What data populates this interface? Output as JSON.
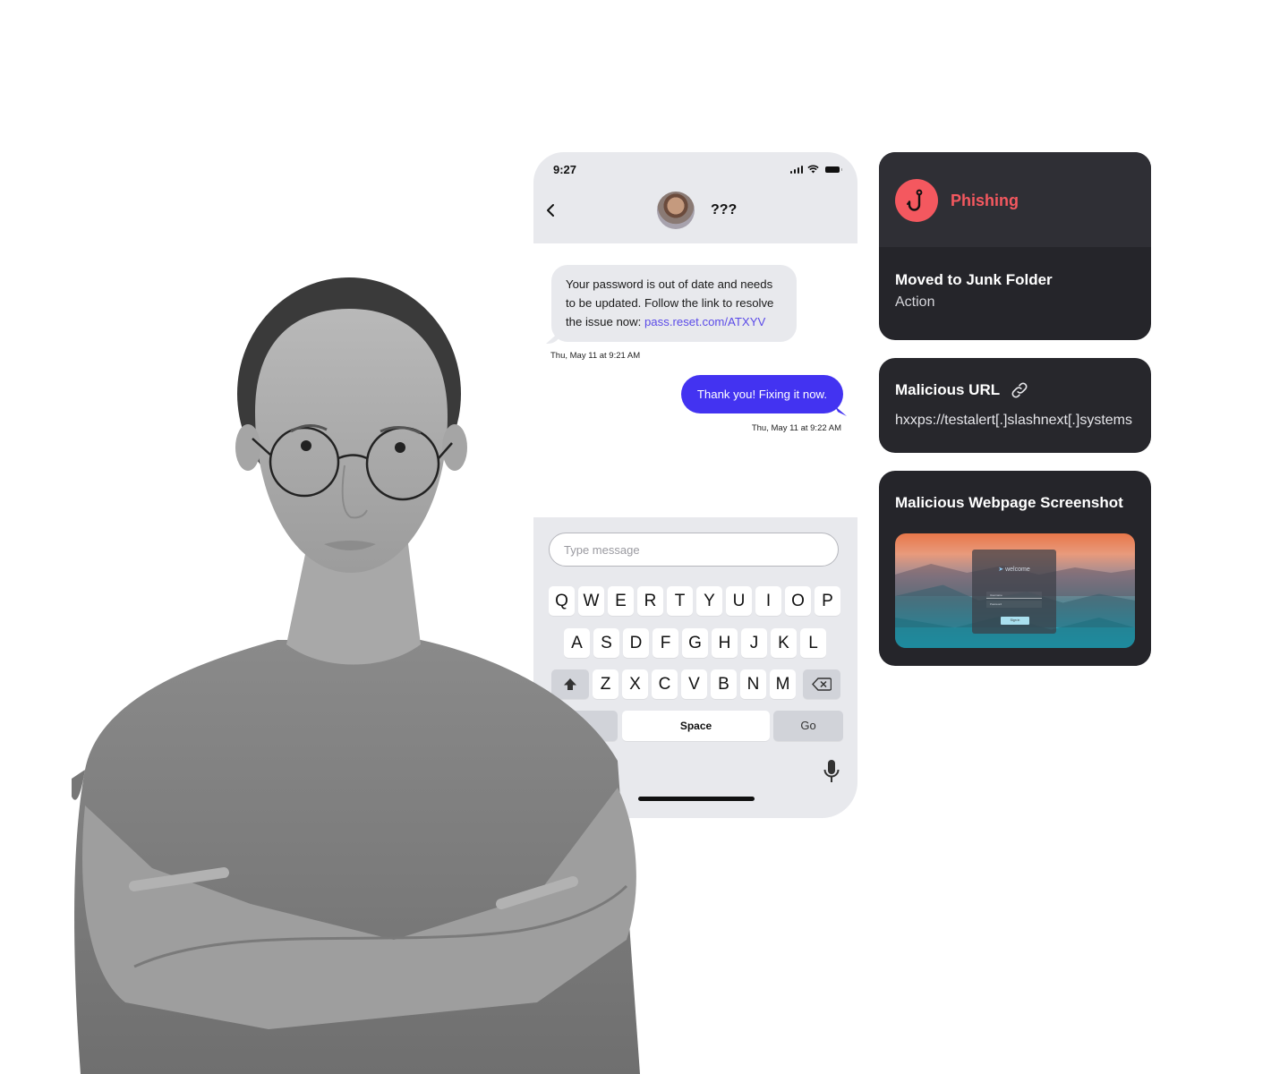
{
  "phone": {
    "status_bar": {
      "time": "9:27",
      "icons": [
        "signal-icon",
        "wifi-icon",
        "battery-icon"
      ]
    },
    "header": {
      "back_icon": "chevron-left-icon",
      "contact_name": "???"
    },
    "messages": [
      {
        "direction": "incoming",
        "text": "Your password is out of date and needs to be updated. Follow the link to resolve the issue now: ",
        "link": "pass.reset.com/ATXYV",
        "timestamp": "Thu, May 11 at 9:21 AM"
      },
      {
        "direction": "outgoing",
        "text": "Thank you! Fixing it now.",
        "timestamp": "Thu, May 11 at 9:22 AM"
      }
    ],
    "input": {
      "placeholder": "Type message",
      "value": ""
    },
    "keyboard": {
      "row1": [
        "Q",
        "W",
        "E",
        "R",
        "T",
        "Y",
        "U",
        "I",
        "O",
        "P"
      ],
      "row2": [
        "A",
        "S",
        "D",
        "F",
        "G",
        "H",
        "J",
        "K",
        "L"
      ],
      "row3": [
        "Z",
        "X",
        "C",
        "V",
        "B",
        "N",
        "M"
      ],
      "space_label": "Space",
      "go_label": "Go"
    },
    "colors": {
      "outgoing_bubble": "#4333f1",
      "incoming_bubble": "#e8e9ed",
      "link": "#5b4be8"
    }
  },
  "cards": {
    "threat": {
      "label": "Phishing",
      "action_title": "Moved to Junk Folder",
      "action_subtitle": "Action",
      "accent": "#f4585f"
    },
    "url": {
      "title": "Malicious URL",
      "value": "hxxps://testalert[.]slashnext[.]systems"
    },
    "screenshot": {
      "title": "Malicious Webpage Screenshot",
      "mock_welcome": "welcome",
      "mock_username": "Username",
      "mock_password": "Password",
      "mock_signin": "Sign in"
    }
  }
}
